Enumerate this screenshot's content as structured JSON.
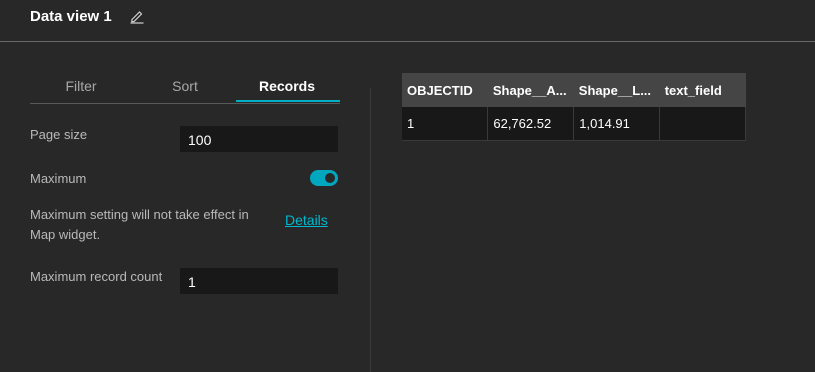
{
  "header": {
    "title": "Data view 1",
    "edit_icon": "pencil-icon"
  },
  "tabs": [
    {
      "label": "Filter",
      "active": false
    },
    {
      "label": "Sort",
      "active": false
    },
    {
      "label": "Records",
      "active": true
    }
  ],
  "accent_color": "#00b0c7",
  "records": {
    "page_size_label": "Page size",
    "page_size_value": "100",
    "maximum_label": "Maximum",
    "maximum_enabled": true,
    "note": "Maximum setting will not take effect in Map widget.",
    "details_link": "Details",
    "max_count_label": "Maximum record count",
    "max_count_value": "1"
  },
  "table": {
    "columns": [
      "OBJECTID",
      "Shape__A...",
      "Shape__L...",
      "text_field"
    ],
    "rows": [
      [
        "1",
        "62,762.52",
        "1,014.91",
        ""
      ]
    ]
  }
}
